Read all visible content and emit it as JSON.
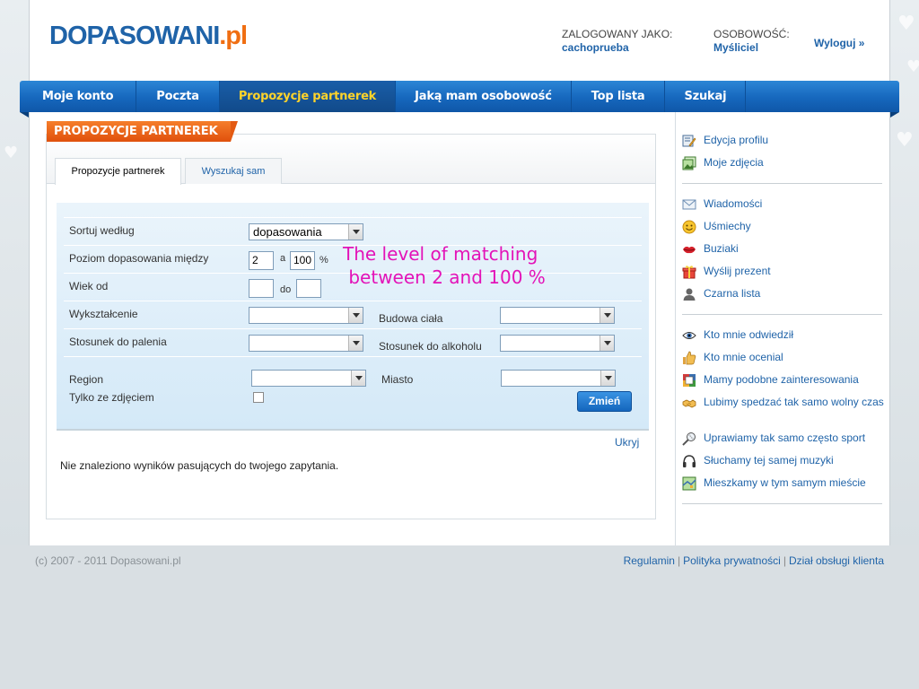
{
  "header": {
    "logo_main": "DOPASOWANI",
    "logo_ext": ".pl",
    "logged_as_label": "ZALOGOWANY JAKO:",
    "username": "cachoprueba",
    "personality_label": "OSOBOWOŚĆ:",
    "personality_value": "Myśliciel",
    "logout": "Wyloguj »"
  },
  "nav": [
    {
      "label": "Moje konto",
      "active": false
    },
    {
      "label": "Poczta",
      "active": false
    },
    {
      "label": "Propozycje partnerek",
      "active": true
    },
    {
      "label": "Jaką mam osobowość",
      "active": false
    },
    {
      "label": "Top lista",
      "active": false
    },
    {
      "label": "Szukaj",
      "active": false
    }
  ],
  "main": {
    "section_title": "PROPOZYCJE PARTNEREK",
    "tabs": [
      {
        "label": "Propozycje partnerek",
        "active": true
      },
      {
        "label": "Wyszukaj sam",
        "active": false
      }
    ],
    "form": {
      "sort_label": "Sortuj według",
      "sort_value": "dopasowania",
      "level_label": "Poziom dopasowania między",
      "level_from": "2",
      "level_and": "a",
      "level_to": "100",
      "level_unit": "%",
      "age_label": "Wiek od",
      "age_from": "",
      "age_to_label": "do",
      "age_to": "",
      "education_label": "Wykształcenie",
      "education_value": "",
      "body_label": "Budowa ciała",
      "body_value": "",
      "smoking_label": "Stosunek do palenia",
      "smoking_value": "",
      "alcohol_label": "Stosunek do alkoholu",
      "alcohol_value": "",
      "region_label": "Region",
      "region_value": "",
      "city_label": "Miasto",
      "city_value": "",
      "photo_label": "Tylko ze zdjęciem",
      "photo_checked": false,
      "submit": "Zmień"
    },
    "annotation": "The level of matching\n between 2 and 100 %",
    "hide_link": "Ukryj",
    "no_results": "Nie znaleziono wyników pasujących do twojego zapytania."
  },
  "sidebar": {
    "group1": [
      {
        "label": "Edycja profilu",
        "icon": "edit-profile-icon"
      },
      {
        "label": "Moje zdjęcia",
        "icon": "photos-icon"
      }
    ],
    "group2": [
      {
        "label": "Wiadomości",
        "icon": "envelope-icon"
      },
      {
        "label": "Uśmiechy",
        "icon": "smiley-icon"
      },
      {
        "label": "Buziaki",
        "icon": "lips-icon"
      },
      {
        "label": "Wyślij prezent",
        "icon": "gift-icon"
      },
      {
        "label": "Czarna lista",
        "icon": "user-silhouette-icon"
      }
    ],
    "group3": [
      {
        "label": "Kto mnie odwiedził",
        "icon": "eye-icon"
      },
      {
        "label": "Kto mnie ocenial",
        "icon": "thumbs-up-icon"
      },
      {
        "label": "Mamy podobne zainteresowania",
        "icon": "puzzle-icon"
      },
      {
        "label": "Lubimy spedzać tak samo wolny czas",
        "icon": "handshake-icon"
      },
      {
        "label": "Uprawiamy tak samo często sport",
        "icon": "racket-icon"
      },
      {
        "label": "Słuchamy tej samej muzyki",
        "icon": "headphones-icon"
      },
      {
        "label": "Mieszkamy w tym samym mieście",
        "icon": "map-icon"
      }
    ]
  },
  "footer": {
    "copyright": "(c) 2007 - 2011 Dopasowani.pl",
    "links": [
      "Regulamin",
      "Polityka prywatności",
      "Dział obsługi klienta"
    ],
    "separator": "|"
  },
  "colors": {
    "brand_blue": "#1f63a8",
    "brand_orange": "#f06e12",
    "nav_active_text": "#ffd42a",
    "annotation": "#e313b8"
  }
}
